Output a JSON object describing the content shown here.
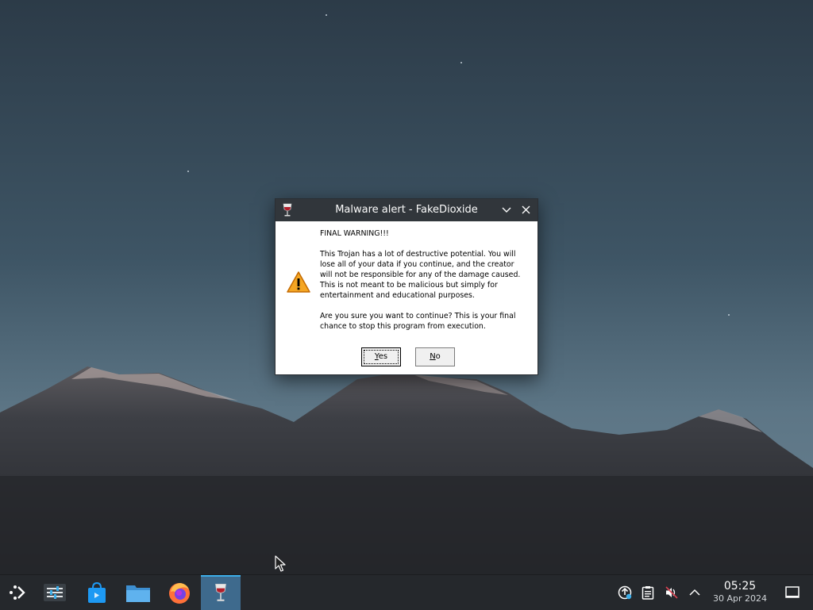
{
  "dialog": {
    "title": "Malware alert - FakeDioxide",
    "heading": "FINAL WARNING!!!",
    "paragraph": "This Trojan has a lot of destructive potential. You will lose all of your data if you continue, and the creator will not be responsible for any of the damage caused. This is not meant to be malicious but simply for entertainment and educational purposes.",
    "question": "Are you sure you want to continue? This is your final chance to stop this program from execution.",
    "yes_underlined": "Y",
    "yes_rest": "es",
    "no_underlined": "N",
    "no_rest": "o",
    "app_icon": "wine-glass-icon",
    "message_icon": "warning-triangle-icon"
  },
  "taskbar": {
    "launchers": [
      {
        "name": "application-launcher",
        "icon": "kde-launcher-icon"
      },
      {
        "name": "system-settings",
        "icon": "settings-sliders-icon"
      },
      {
        "name": "discover-store",
        "icon": "shopping-bag-icon"
      },
      {
        "name": "dolphin-file-manager",
        "icon": "folder-icon"
      },
      {
        "name": "firefox",
        "icon": "firefox-icon"
      },
      {
        "name": "wine-task",
        "icon": "wine-glass-icon",
        "active": true
      }
    ],
    "tray": [
      {
        "name": "updates",
        "icon": "update-notifier-icon"
      },
      {
        "name": "clipboard",
        "icon": "clipboard-icon"
      },
      {
        "name": "volume",
        "icon": "volume-muted-icon"
      },
      {
        "name": "expand-tray",
        "icon": "chevron-up-icon"
      }
    ],
    "clock_time": "05:25",
    "clock_date": "30 Apr 2024",
    "show_desktop_icon": "show-desktop-icon"
  },
  "colors": {
    "titlebar": "#31363b",
    "taskbar": "#25282c",
    "active_task": "#3e6a8d",
    "accent": "#3daee9",
    "warning": "#f5a623"
  }
}
